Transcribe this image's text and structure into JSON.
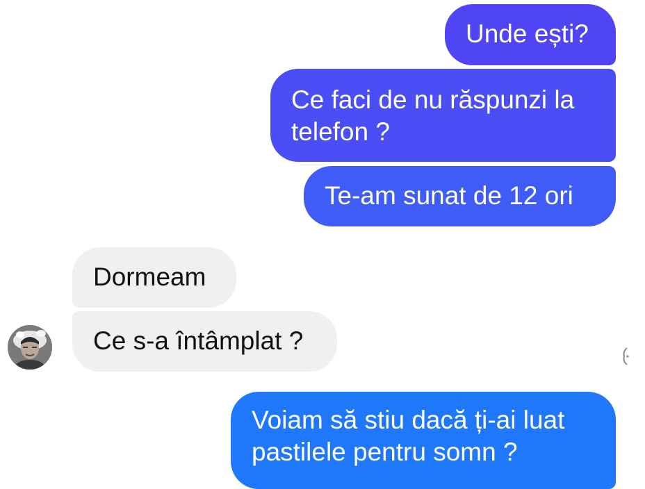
{
  "conversation": {
    "messages": [
      {
        "sender": "me",
        "text": "Unde ești?"
      },
      {
        "sender": "me",
        "text": "Ce faci de nu răspunzi la\ntelefon  ?"
      },
      {
        "sender": "me",
        "text": "Te-am sunat de 12 ori"
      },
      {
        "sender": "contact",
        "text": "Dormeam"
      },
      {
        "sender": "contact",
        "text": "Ce s-a întâmplat ?"
      },
      {
        "sender": "me",
        "text": "Voiam să stiu dacă ți-ai luat\npastilele pentru somn ?"
      }
    ]
  },
  "contact": {
    "avatar_icon": "user-avatar-photo"
  },
  "colors": {
    "outgoing_bubble_top": "#5045f4",
    "outgoing_bubble_mid": "#4a4ef4",
    "outgoing_bubble_low": "#3f5cf6",
    "outgoing_bubble_latest": "#1f78fa",
    "incoming_bubble": "#f1f0f0"
  }
}
